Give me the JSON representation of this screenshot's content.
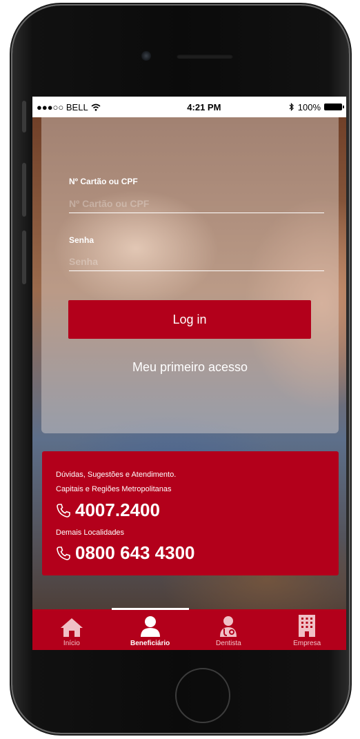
{
  "status_bar": {
    "carrier": "●●●○○ BELL",
    "time": "4:21 PM",
    "battery": "100%"
  },
  "login": {
    "card_label": "Nº Cartão ou CPF",
    "card_placeholder": "Nº Cartão ou CPF",
    "password_label": "Senha",
    "password_placeholder": "Senha",
    "login_button": "Log in",
    "first_access": "Meu primeiro acesso"
  },
  "contact": {
    "intro": "Dúvidas, Sugestões e Atendimento.",
    "region1": "Capitais e Regiões Metropolitanas",
    "phone1": "4007.2400",
    "region2": "Demais Localidades",
    "phone2": "0800 643 4300"
  },
  "tabs": [
    {
      "label": "Início",
      "icon": "home-icon"
    },
    {
      "label": "Beneficiário",
      "icon": "user-icon",
      "active": true
    },
    {
      "label": "Dentista",
      "icon": "doctor-icon"
    },
    {
      "label": "Empresa",
      "icon": "building-icon"
    }
  ],
  "colors": {
    "brand_red": "#b3001b"
  }
}
